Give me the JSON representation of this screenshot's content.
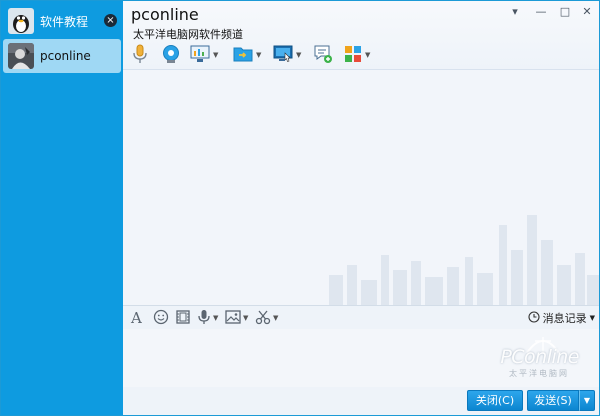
{
  "sidebar": {
    "contacts": [
      {
        "name": "软件教程",
        "avatar": "penguin-avatar-icon"
      },
      {
        "name": "pconline",
        "avatar": "user-photo-avatar"
      }
    ],
    "close_label": "×"
  },
  "chat": {
    "title": "pconline",
    "subtitle": "太平洋电脑网软件频道"
  },
  "window_controls": {
    "menu": "▾",
    "minimize": "—",
    "maximize": "□",
    "close": "✕"
  },
  "toolbar": [
    "voice-call-icon",
    "video-call-icon",
    "screen-share-icon",
    "file-transfer-icon",
    "remote-assist-icon",
    "create-discussion-icon",
    "apps-icon"
  ],
  "input_toolbar": {
    "font_glyph": "A",
    "history_label": "消息记录"
  },
  "watermark": {
    "text": "PConline",
    "sub": "太平洋电脑网"
  },
  "footer": {
    "close_label": "关闭(C)",
    "send_label": "发送(S)"
  },
  "colors": {
    "sidebar": "#0e9be0",
    "selected": "#9fd8f4",
    "button": "#1597de"
  }
}
